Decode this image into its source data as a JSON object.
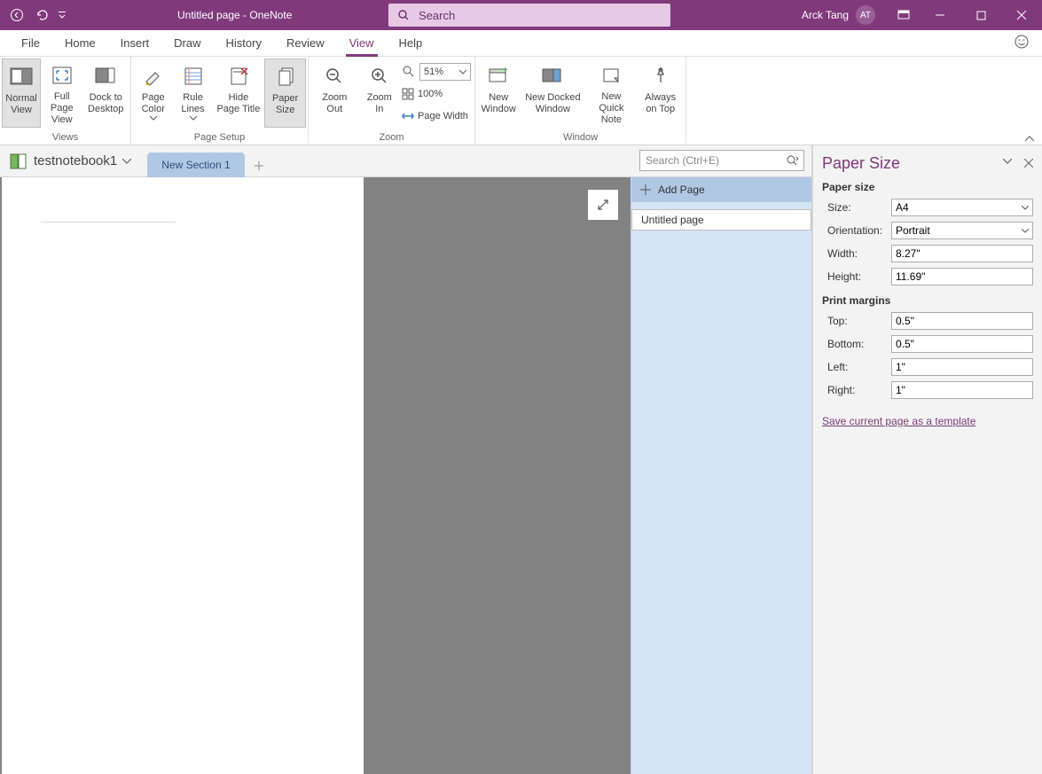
{
  "titlebar": {
    "title": "Untitled page  -  OneNote",
    "search_placeholder": "Search",
    "user_name": "Arck Tang",
    "user_initials": "AT"
  },
  "menu": {
    "file": "File",
    "home": "Home",
    "insert": "Insert",
    "draw": "Draw",
    "history": "History",
    "review": "Review",
    "view": "View",
    "help": "Help"
  },
  "ribbon": {
    "views_group": "Views",
    "normal_view": "Normal View",
    "full_page_view": "Full Page View",
    "dock_to_desktop": "Dock to Desktop",
    "page_setup_group": "Page Setup",
    "page_color": "Page Color",
    "rule_lines": "Rule Lines",
    "hide_page_title": "Hide Page Title",
    "paper_size": "Paper Size",
    "zoom_group": "Zoom",
    "zoom_out": "Zoom Out",
    "zoom_in": "Zoom In",
    "zoom_value": "51%",
    "hundred": "100%",
    "page_width": "Page Width",
    "window_group": "Window",
    "new_window": "New Window",
    "new_docked_window": "New Docked Window",
    "new_quick_note": "New Quick Note",
    "always_on_top": "Always on Top"
  },
  "notebook": {
    "name": "testnotebook1",
    "section1": "New Section 1",
    "search_placeholder": "Search (Ctrl+E)",
    "add_page": "Add Page",
    "page1": "Untitled page"
  },
  "pane": {
    "title": "Paper Size",
    "section_size": "Paper size",
    "size_label": "Size:",
    "size_value": "A4",
    "orientation_label": "Orientation:",
    "orientation_value": "Portrait",
    "width_label": "Width:",
    "width_value": "8.27\"",
    "height_label": "Height:",
    "height_value": "11.69\"",
    "section_margins": "Print margins",
    "top_label": "Top:",
    "top_value": "0.5\"",
    "bottom_label": "Bottom:",
    "bottom_value": "0.5\"",
    "left_label": "Left:",
    "left_value": "1\"",
    "right_label": "Right:",
    "right_value": "1\"",
    "save_template": "Save current page as a template"
  }
}
